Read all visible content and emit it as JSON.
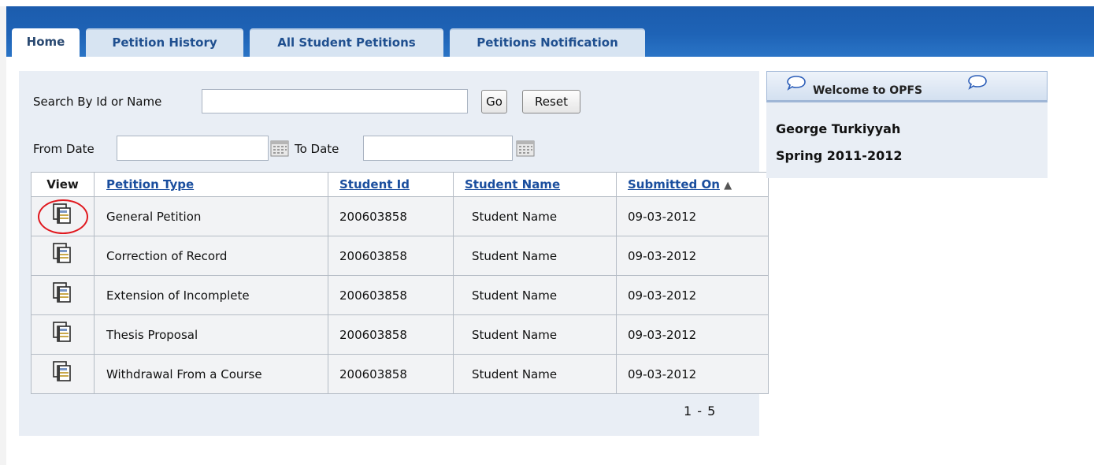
{
  "tabs": [
    {
      "label": "Home",
      "active": true
    },
    {
      "label": "Petition History",
      "active": false
    },
    {
      "label": "All Student Petitions",
      "active": false
    },
    {
      "label": "Petitions Notification",
      "active": false
    }
  ],
  "search": {
    "label": "Search By Id or Name",
    "value": "",
    "go_label": "Go",
    "reset_label": "Reset",
    "from_date_label": "From Date",
    "from_date_value": "",
    "to_date_label": "To Date",
    "to_date_value": ""
  },
  "table": {
    "headers": {
      "view": "View",
      "petition_type": "Petition Type",
      "student_id": "Student Id",
      "student_name": "Student Name",
      "submitted_on": "Submitted On"
    },
    "sort_indicator": "▲",
    "rows": [
      {
        "petition_type": "General Petition",
        "student_id": "200603858",
        "student_name": "Student Name",
        "submitted_on": "09-03-2012",
        "highlighted": true
      },
      {
        "petition_type": "Correction of Record",
        "student_id": "200603858",
        "student_name": "Student Name",
        "submitted_on": "09-03-2012",
        "highlighted": false
      },
      {
        "petition_type": "Extension of Incomplete",
        "student_id": "200603858",
        "student_name": "Student Name",
        "submitted_on": "09-03-2012",
        "highlighted": false
      },
      {
        "petition_type": "Thesis Proposal",
        "student_id": "200603858",
        "student_name": "Student Name",
        "submitted_on": "09-03-2012",
        "highlighted": false
      },
      {
        "petition_type": "Withdrawal From a Course",
        "student_id": "200603858",
        "student_name": "Student Name",
        "submitted_on": "09-03-2012",
        "highlighted": false
      }
    ],
    "pager": "1 - 5"
  },
  "welcome": {
    "title": "Welcome to OPFS",
    "user_name": "George Turkiyyah",
    "term": "Spring 2011-2012"
  },
  "colors": {
    "header_blue": "#1e63b6",
    "panel_bg": "#e9eef5",
    "link_blue": "#1a4e9e",
    "highlight_circle": "#e0181e"
  },
  "icons": {
    "view": "view-document-icon",
    "calendar": "calendar-icon",
    "bubble": "speech-bubble-icon",
    "sort": "sort-ascending-icon"
  }
}
